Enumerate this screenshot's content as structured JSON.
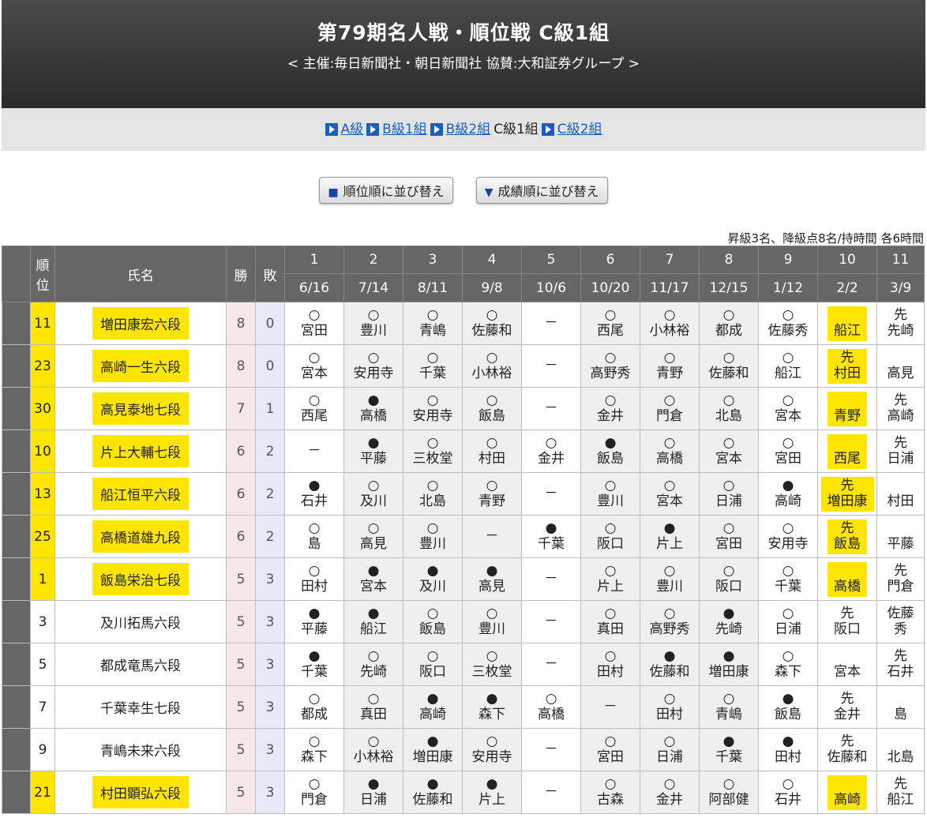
{
  "header": {
    "title": "第79期名人戦・順位戦 C級1組",
    "subtitle": "< 主催:毎日新聞社・朝日新聞社 協賛:大和証券グループ >"
  },
  "nav": {
    "items": [
      {
        "label": "A級",
        "link": true
      },
      {
        "label": "B級1組",
        "link": true
      },
      {
        "label": "B級2組",
        "link": true
      },
      {
        "label": "C級1組",
        "link": false
      },
      {
        "label": "C級2組",
        "link": true
      }
    ]
  },
  "sort": {
    "rank_label": "順位順に並び替え",
    "result_label": "成績順に並び替え"
  },
  "note": "昇級3名、降級点8名/持時間 各6時間",
  "table": {
    "headers": {
      "rank": "順位",
      "name": "氏名",
      "wins": "勝",
      "losses": "敗"
    },
    "rounds": [
      {
        "no": "1",
        "date": "6/16"
      },
      {
        "no": "2",
        "date": "7/14"
      },
      {
        "no": "3",
        "date": "8/11"
      },
      {
        "no": "4",
        "date": "9/8"
      },
      {
        "no": "5",
        "date": "10/6"
      },
      {
        "no": "6",
        "date": "10/20"
      },
      {
        "no": "7",
        "date": "11/17"
      },
      {
        "no": "8",
        "date": "12/15"
      },
      {
        "no": "9",
        "date": "1/12"
      },
      {
        "no": "10",
        "date": "2/2"
      },
      {
        "no": "11",
        "date": "3/9"
      }
    ],
    "rows": [
      {
        "rank": "11",
        "name": "増田康宏六段",
        "w": "8",
        "l": "0",
        "hl": true,
        "games": [
          [
            "○",
            "宮田"
          ],
          [
            "○",
            "豊川"
          ],
          [
            "○",
            "青嶋"
          ],
          [
            "○",
            "佐藤和"
          ],
          [
            "－",
            ""
          ],
          [
            "○",
            "西尾"
          ],
          [
            "○",
            "小林裕"
          ],
          [
            "○",
            "都成"
          ],
          [
            "○",
            "佐藤秀"
          ],
          [
            "",
            "船江"
          ],
          [
            "先",
            "先崎"
          ]
        ],
        "hl10": true
      },
      {
        "rank": "23",
        "name": "高崎一生六段",
        "w": "8",
        "l": "0",
        "hl": true,
        "games": [
          [
            "○",
            "宮本"
          ],
          [
            "○",
            "安用寺"
          ],
          [
            "○",
            "千葉"
          ],
          [
            "○",
            "小林裕"
          ],
          [
            "－",
            ""
          ],
          [
            "○",
            "高野秀"
          ],
          [
            "○",
            "青野"
          ],
          [
            "○",
            "佐藤和"
          ],
          [
            "○",
            "船江"
          ],
          [
            "先",
            "村田"
          ],
          [
            "",
            "高見"
          ]
        ],
        "hl10": true
      },
      {
        "rank": "30",
        "name": "高見泰地七段",
        "w": "7",
        "l": "1",
        "hl": true,
        "games": [
          [
            "○",
            "西尾"
          ],
          [
            "●",
            "高橋"
          ],
          [
            "○",
            "安用寺"
          ],
          [
            "○",
            "飯島"
          ],
          [
            "－",
            ""
          ],
          [
            "○",
            "金井"
          ],
          [
            "○",
            "門倉"
          ],
          [
            "○",
            "北島"
          ],
          [
            "○",
            "宮本"
          ],
          [
            "",
            "青野"
          ],
          [
            "先",
            "高崎"
          ]
        ],
        "hl10": true
      },
      {
        "rank": "10",
        "name": "片上大輔七段",
        "w": "6",
        "l": "2",
        "hl": true,
        "games": [
          [
            "－",
            ""
          ],
          [
            "●",
            "平藤"
          ],
          [
            "○",
            "三枚堂"
          ],
          [
            "○",
            "村田"
          ],
          [
            "○",
            "金井"
          ],
          [
            "●",
            "飯島"
          ],
          [
            "○",
            "高橋"
          ],
          [
            "○",
            "宮本"
          ],
          [
            "○",
            "宮田"
          ],
          [
            "",
            "西尾"
          ],
          [
            "先",
            "日浦"
          ]
        ],
        "hl10": true
      },
      {
        "rank": "13",
        "name": "船江恒平六段",
        "w": "6",
        "l": "2",
        "hl": true,
        "games": [
          [
            "●",
            "石井"
          ],
          [
            "○",
            "及川"
          ],
          [
            "○",
            "北島"
          ],
          [
            "○",
            "青野"
          ],
          [
            "－",
            ""
          ],
          [
            "○",
            "豊川"
          ],
          [
            "○",
            "宮本"
          ],
          [
            "○",
            "日浦"
          ],
          [
            "●",
            "高崎"
          ],
          [
            "先",
            "増田康"
          ],
          [
            "",
            "村田"
          ]
        ],
        "hl10": true
      },
      {
        "rank": "25",
        "name": "高橋道雄九段",
        "w": "6",
        "l": "2",
        "hl": true,
        "games": [
          [
            "○",
            "島"
          ],
          [
            "○",
            "高見"
          ],
          [
            "○",
            "豊川"
          ],
          [
            "－",
            ""
          ],
          [
            "●",
            "千葉"
          ],
          [
            "○",
            "阪口"
          ],
          [
            "●",
            "片上"
          ],
          [
            "○",
            "宮田"
          ],
          [
            "○",
            "安用寺"
          ],
          [
            "先",
            "飯島"
          ],
          [
            "",
            "平藤"
          ]
        ],
        "hl10": true
      },
      {
        "rank": "1",
        "name": "飯島栄治七段",
        "w": "5",
        "l": "3",
        "hl": true,
        "games": [
          [
            "○",
            "田村"
          ],
          [
            "●",
            "宮本"
          ],
          [
            "●",
            "及川"
          ],
          [
            "●",
            "高見"
          ],
          [
            "－",
            ""
          ],
          [
            "○",
            "片上"
          ],
          [
            "○",
            "豊川"
          ],
          [
            "○",
            "阪口"
          ],
          [
            "○",
            "千葉"
          ],
          [
            "",
            "高橋"
          ],
          [
            "先",
            "門倉"
          ]
        ],
        "hl10": true
      },
      {
        "rank": "3",
        "name": "及川拓馬六段",
        "w": "5",
        "l": "3",
        "hl": false,
        "games": [
          [
            "●",
            "平藤"
          ],
          [
            "●",
            "船江"
          ],
          [
            "○",
            "飯島"
          ],
          [
            "○",
            "豊川"
          ],
          [
            "－",
            ""
          ],
          [
            "○",
            "真田"
          ],
          [
            "○",
            "高野秀"
          ],
          [
            "●",
            "先崎"
          ],
          [
            "○",
            "日浦"
          ],
          [
            "先",
            "阪口"
          ],
          [
            "佐藤",
            "秀"
          ]
        ],
        "hl10": false
      },
      {
        "rank": "5",
        "name": "都成竜馬六段",
        "w": "5",
        "l": "3",
        "hl": false,
        "games": [
          [
            "●",
            "千葉"
          ],
          [
            "○",
            "先崎"
          ],
          [
            "○",
            "阪口"
          ],
          [
            "○",
            "三枚堂"
          ],
          [
            "－",
            ""
          ],
          [
            "○",
            "田村"
          ],
          [
            "●",
            "佐藤和"
          ],
          [
            "●",
            "増田康"
          ],
          [
            "○",
            "森下"
          ],
          [
            "",
            "宮本"
          ],
          [
            "先",
            "石井"
          ]
        ],
        "hl10": false
      },
      {
        "rank": "7",
        "name": "千葉幸生七段",
        "w": "5",
        "l": "3",
        "hl": false,
        "games": [
          [
            "○",
            "都成"
          ],
          [
            "○",
            "真田"
          ],
          [
            "●",
            "高崎"
          ],
          [
            "●",
            "森下"
          ],
          [
            "○",
            "高橋"
          ],
          [
            "－",
            ""
          ],
          [
            "○",
            "田村"
          ],
          [
            "○",
            "青嶋"
          ],
          [
            "●",
            "飯島"
          ],
          [
            "先",
            "金井"
          ],
          [
            "",
            "島"
          ]
        ],
        "hl10": false
      },
      {
        "rank": "9",
        "name": "青嶋未来六段",
        "w": "5",
        "l": "3",
        "hl": false,
        "games": [
          [
            "○",
            "森下"
          ],
          [
            "○",
            "小林裕"
          ],
          [
            "●",
            "増田康"
          ],
          [
            "○",
            "安用寺"
          ],
          [
            "－",
            ""
          ],
          [
            "○",
            "宮田"
          ],
          [
            "○",
            "日浦"
          ],
          [
            "●",
            "千葉"
          ],
          [
            "●",
            "田村"
          ],
          [
            "先",
            "佐藤和"
          ],
          [
            "",
            "北島"
          ]
        ],
        "hl10": false
      },
      {
        "rank": "21",
        "name": "村田顕弘六段",
        "w": "5",
        "l": "3",
        "hl": true,
        "games": [
          [
            "○",
            "門倉"
          ],
          [
            "●",
            "日浦"
          ],
          [
            "●",
            "佐藤和"
          ],
          [
            "●",
            "片上"
          ],
          [
            "－",
            ""
          ],
          [
            "○",
            "古森"
          ],
          [
            "○",
            "金井"
          ],
          [
            "○",
            "阿部健"
          ],
          [
            "○",
            "石井"
          ],
          [
            "",
            "高崎"
          ],
          [
            "先",
            "船江"
          ]
        ],
        "hl10": true
      }
    ]
  }
}
